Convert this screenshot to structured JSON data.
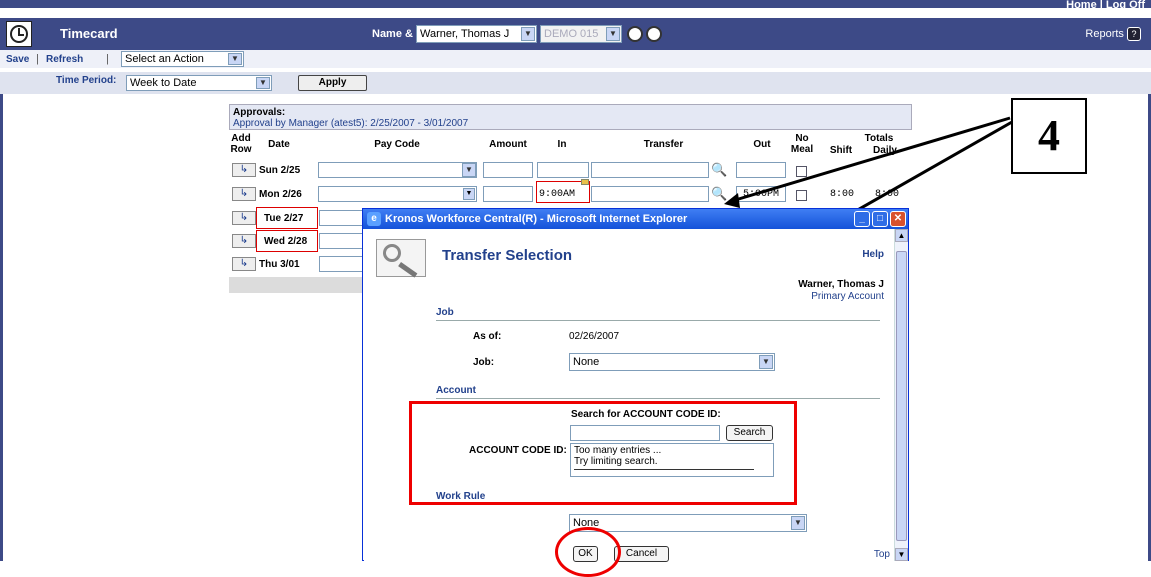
{
  "top_links": {
    "home": "Home",
    "sep": "|",
    "logoff": "Log Off"
  },
  "header": {
    "title": "Timecard",
    "name_id_label": "Name & ID:",
    "employee_select": "Warner, Thomas J",
    "id_select": "DEMO 015",
    "reports": "Reports",
    "help_glyph": "?"
  },
  "toolbar": {
    "save": "Save",
    "refresh": "Refresh",
    "sep": "|",
    "action_select": "Select an Action"
  },
  "time_period": {
    "label": "Time Period:",
    "value": "Week to Date",
    "apply": "Apply"
  },
  "approvals": {
    "title": "Approvals:",
    "detail": "Approval by Manager (atest5): 2/25/2007 - 3/01/2007"
  },
  "table": {
    "headers": {
      "add_row": "Add Row",
      "date": "Date",
      "pay_code": "Pay Code",
      "amount": "Amount",
      "in": "In",
      "transfer": "Transfer",
      "out": "Out",
      "no_meal": "No Meal",
      "totals": "Totals",
      "shift": "Shift",
      "daily": "Daily"
    },
    "rows": [
      {
        "date": "Sun 2/25",
        "in": "",
        "out": "",
        "shift": "",
        "daily": ""
      },
      {
        "date": "Mon 2/26",
        "in": "9:00AM",
        "out": "5:00PM",
        "shift": "8:00",
        "daily": "8:00"
      },
      {
        "date": "Tue 2/27"
      },
      {
        "date": "Wed 2/28"
      },
      {
        "date": "Thu 3/01"
      }
    ]
  },
  "callout": "4",
  "popup": {
    "window_title": "Kronos Workforce Central(R) - Microsoft Internet Explorer",
    "title": "Transfer Selection",
    "help": "Help",
    "employee": "Warner, Thomas J",
    "primary_account": "Primary Account",
    "job_section": "Job",
    "as_of_label": "As of:",
    "as_of_value": "02/26/2007",
    "job_label": "Job:",
    "job_value": "None",
    "account_section": "Account",
    "search_label": "Search for ACCOUNT CODE ID:",
    "search_button": "Search",
    "account_code_label": "ACCOUNT CODE ID:",
    "account_list": [
      "Too many entries ...",
      "Try limiting search."
    ],
    "work_rule_section": "Work Rule",
    "work_rule_value": "None",
    "ok": "OK",
    "cancel": "Cancel",
    "top_link": "Top"
  },
  "colors": {
    "header_bg": "#3d4a87",
    "link": "#22418c",
    "highlight": "#e00000"
  }
}
